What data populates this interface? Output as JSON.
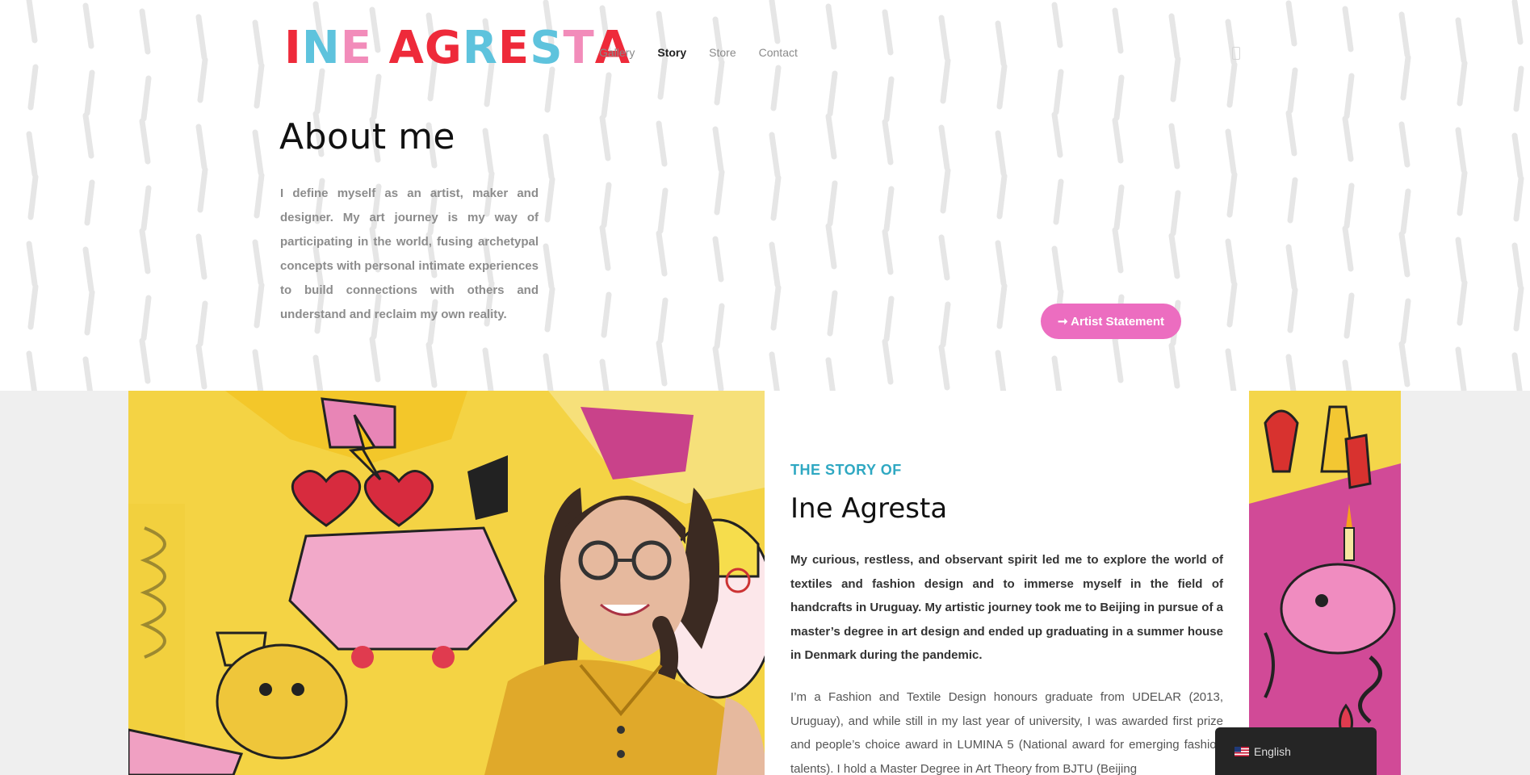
{
  "header": {
    "logo_text": "INE AGRESTA",
    "logo_colors": [
      "#ee2a3a",
      "#5ec3dd",
      "#f28cba"
    ],
    "nav": [
      {
        "label": "Gallery",
        "active": false
      },
      {
        "label": "Story",
        "active": true
      },
      {
        "label": "Store",
        "active": false
      },
      {
        "label": "Contact",
        "active": false
      }
    ]
  },
  "about": {
    "title": "About me",
    "text": "I define myself as an artist, maker and designer. My art journey is my way of participating in the world, fusing archetypal concepts with personal intimate experiences to build connections with others and understand and reclaim my own reality.",
    "button_label": "➞ Artist Statement",
    "button_color": "#ec6dc0"
  },
  "story": {
    "kicker": "THE STORY OF",
    "title": "Ine Agresta",
    "paragraph1": "My curious, restless, and observant spirit led me to explore the world of textiles and fashion design and to immerse myself in the field of handcrafts in Uruguay. My artistic journey took me to Beijing in pursue of a master’s degree in art design and ended up graduating in a summer house in Denmark during the pandemic.",
    "paragraph2": "I’m a Fashion and Textile Design honours graduate from UDELAR (2013, Uruguay), and while still in my last year of university, I was awarded first prize and people’s choice award in LUMINA 5 (National award for emerging fashion talents). I hold a Master Degree in Art Theory from BJTU (Beijing",
    "kicker_color": "#2fa8c2"
  },
  "language": {
    "label": "English",
    "flag_icon": "us-flag-icon"
  }
}
